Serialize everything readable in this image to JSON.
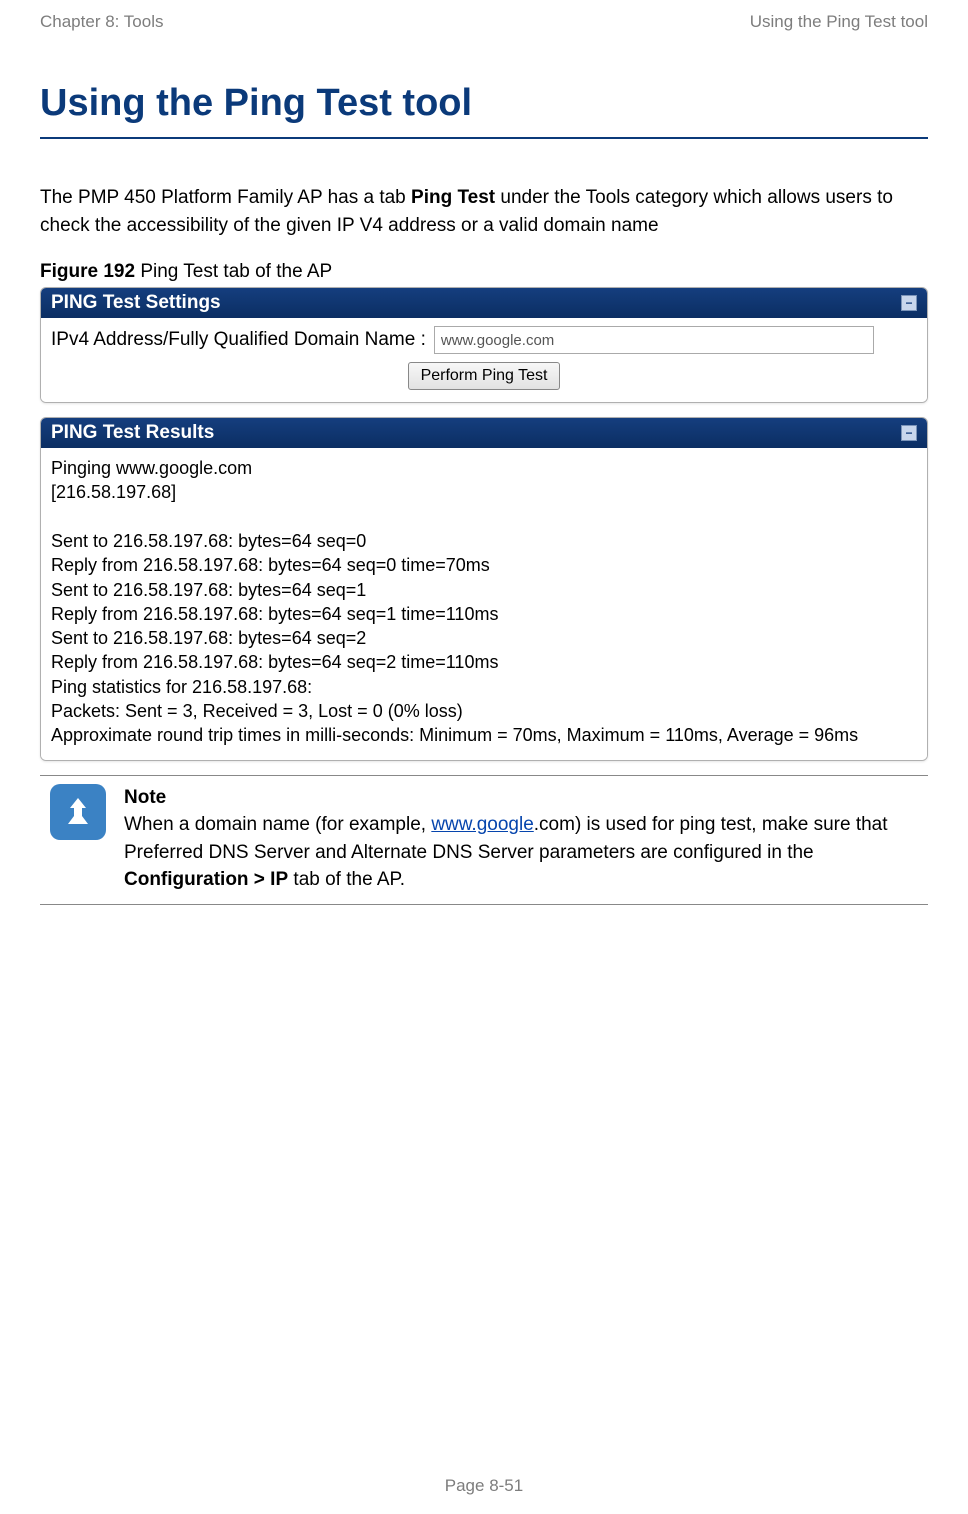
{
  "header": {
    "left": "Chapter 8:  Tools",
    "right": "Using the Ping Test tool"
  },
  "title": "Using the Ping Test tool",
  "intro": {
    "part1": "The PMP 450 Platform Family AP has a tab ",
    "bold1": "Ping Test",
    "part2": " under the Tools category which allows users to check the accessibility of the given IP V4 address or a valid domain name"
  },
  "figure": {
    "label_bold": "Figure 192",
    "label_rest": " Ping Test tab of the AP"
  },
  "panel_settings": {
    "title": "PING Test Settings",
    "collapse_glyph": "−",
    "field_label": "IPv4 Address/Fully Qualified Domain Name :",
    "field_value": "www.google.com",
    "button_label": "Perform Ping Test"
  },
  "panel_results": {
    "title": "PING Test Results",
    "collapse_glyph": "−",
    "lines": "Pinging www.google.com\n[216.58.197.68]\n\nSent to 216.58.197.68: bytes=64 seq=0\nReply from 216.58.197.68: bytes=64 seq=0 time=70ms\nSent to 216.58.197.68: bytes=64 seq=1\nReply from 216.58.197.68: bytes=64 seq=1 time=110ms\nSent to 216.58.197.68: bytes=64 seq=2\nReply from 216.58.197.68: bytes=64 seq=2 time=110ms\nPing statistics for 216.58.197.68:\nPackets: Sent = 3, Received = 3, Lost = 0 (0% loss)\nApproximate round trip times in milli-seconds: Minimum = 70ms, Maximum = 110ms, Average = 96ms"
  },
  "note": {
    "title": "Note",
    "part1": "When a domain name (for example, ",
    "link_text": "www.google",
    "part2": ".com) is used for ping test, make sure that Preferred DNS Server and Alternate DNS Server parameters are configured in the ",
    "bold": "Configuration > IP",
    "part3": " tab of the AP."
  },
  "footer": {
    "page": "Page 8-51"
  }
}
